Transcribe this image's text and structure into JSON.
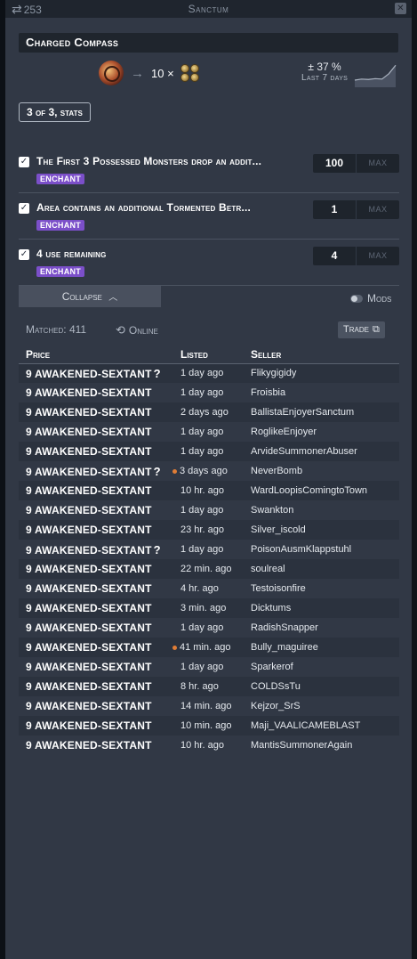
{
  "titlebar": {
    "count": "253",
    "title": "Sanctum",
    "close_glyph": "✕"
  },
  "item": {
    "name": "Charged Compass",
    "price_amount": "10 ×",
    "icon": "charged-compass-icon",
    "currency_icon": "awakened-sextant-icon"
  },
  "trend": {
    "change": "± 37 %",
    "period": "Last 7 days",
    "sparkline": [
      0.25,
      0.3,
      0.28,
      0.32,
      0.3,
      0.55,
      0.95
    ]
  },
  "stats_button": "3 of 3, stats",
  "filters": [
    {
      "text": "The First 3 Possessed Monsters drop an addit...",
      "tag": "ENCHANT",
      "value": "100",
      "max_placeholder": "MAX",
      "checked": true
    },
    {
      "text": "Area contains an additional Tormented Betr...",
      "tag": "ENCHANT",
      "value": "1",
      "max_placeholder": "MAX",
      "checked": true
    },
    {
      "text": "4 use remaining",
      "tag": "ENCHANT",
      "value": "4",
      "max_placeholder": "MAX",
      "checked": true
    }
  ],
  "collapse_label": "Collapse",
  "mods_label": "Mods",
  "matched_label": "Matched: 411",
  "online_label": "Online",
  "trade_label": "Trade",
  "table": {
    "headers": [
      "Price",
      "Listed",
      "Seller"
    ],
    "rows": [
      {
        "price": "9 AWAKENED-SEXTANT",
        "q": "?",
        "dot": false,
        "listed": "1 day ago",
        "seller": "Flikygigidy"
      },
      {
        "price": "9 AWAKENED-SEXTANT",
        "q": "",
        "dot": false,
        "listed": "1 day ago",
        "seller": "Froisbia"
      },
      {
        "price": "9 AWAKENED-SEXTANT",
        "q": "",
        "dot": false,
        "listed": "2 days ago",
        "seller": "BallistaEnjoyerSanctum"
      },
      {
        "price": "9 AWAKENED-SEXTANT",
        "q": "",
        "dot": false,
        "listed": "1 day ago",
        "seller": "RoglikeEnjoyer"
      },
      {
        "price": "9 AWAKENED-SEXTANT",
        "q": "",
        "dot": false,
        "listed": "1 day ago",
        "seller": "ArvideSummonerAbuser"
      },
      {
        "price": "9 AWAKENED-SEXTANT",
        "q": "?",
        "dot": true,
        "listed": "3 days ago",
        "seller": "NeverBomb"
      },
      {
        "price": "9 AWAKENED-SEXTANT",
        "q": "",
        "dot": false,
        "listed": "10 hr. ago",
        "seller": "WardLoopisComingtoTown"
      },
      {
        "price": "9 AWAKENED-SEXTANT",
        "q": "",
        "dot": false,
        "listed": "1 day ago",
        "seller": "Swankton"
      },
      {
        "price": "9 AWAKENED-SEXTANT",
        "q": "",
        "dot": false,
        "listed": "23 hr. ago",
        "seller": "Silver_iscold"
      },
      {
        "price": "9 AWAKENED-SEXTANT",
        "q": "?",
        "dot": false,
        "listed": "1 day ago",
        "seller": "PoisonAusmKlappstuhl"
      },
      {
        "price": "9 AWAKENED-SEXTANT",
        "q": "",
        "dot": false,
        "listed": "22 min. ago",
        "seller": "soulreal"
      },
      {
        "price": "9 AWAKENED-SEXTANT",
        "q": "",
        "dot": false,
        "listed": "4 hr. ago",
        "seller": "Testoisonfire"
      },
      {
        "price": "9 AWAKENED-SEXTANT",
        "q": "",
        "dot": false,
        "listed": "3 min. ago",
        "seller": "Dicktums"
      },
      {
        "price": "9 AWAKENED-SEXTANT",
        "q": "",
        "dot": false,
        "listed": "1 day ago",
        "seller": "RadishSnapper"
      },
      {
        "price": "9 AWAKENED-SEXTANT",
        "q": "",
        "dot": true,
        "listed": "41 min. ago",
        "seller": "Bully_maguiree"
      },
      {
        "price": "9 AWAKENED-SEXTANT",
        "q": "",
        "dot": false,
        "listed": "1 day ago",
        "seller": "Sparkerof"
      },
      {
        "price": "9 AWAKENED-SEXTANT",
        "q": "",
        "dot": false,
        "listed": "8 hr. ago",
        "seller": "COLDSsTu"
      },
      {
        "price": "9 AWAKENED-SEXTANT",
        "q": "",
        "dot": false,
        "listed": "14 min. ago",
        "seller": "Kejzor_SrS"
      },
      {
        "price": "9 AWAKENED-SEXTANT",
        "q": "",
        "dot": false,
        "listed": "10 min. ago",
        "seller": "Maji_VAALICAMEBLAST"
      },
      {
        "price": "9 AWAKENED-SEXTANT",
        "q": "",
        "dot": false,
        "listed": "10 hr. ago",
        "seller": "MantisSummonerAgain"
      }
    ]
  },
  "colors": {
    "panel": "#313845",
    "enchant_tag": "#7b4fc9",
    "new_dot": "#e07d36"
  }
}
